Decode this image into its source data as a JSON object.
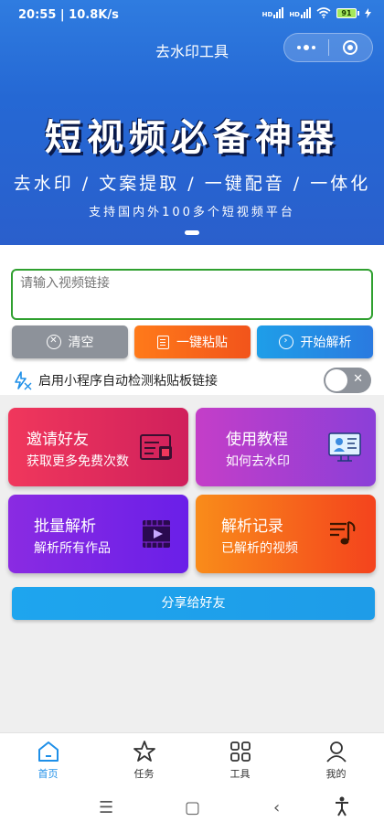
{
  "status": {
    "time": "20:55 | 10.8K/s",
    "battery": "91",
    "net1": "HD",
    "net2": "HD"
  },
  "nav": {
    "title": "去水印工具"
  },
  "banner": {
    "title": "短视频必备神器",
    "subtitle": "去水印 / 文案提取 / 一键配音 / 一体化",
    "note": "支持国内外100多个短视频平台"
  },
  "input": {
    "placeholder": "请输入视频链接",
    "value": ""
  },
  "buttons": {
    "clear": "清空",
    "paste": "一键粘贴",
    "parse": "开始解析"
  },
  "auto": {
    "label": "启用小程序自动检测粘贴板链接",
    "toggle_on": false
  },
  "cards": [
    {
      "title": "邀请好友",
      "sub": "获取更多免费次数",
      "icon": "invite-icon"
    },
    {
      "title": "使用教程",
      "sub": "如何去水印",
      "icon": "tutorial-icon"
    },
    {
      "title": "批量解析",
      "sub": "解析所有作品",
      "icon": "batch-video-icon"
    },
    {
      "title": "解析记录",
      "sub": "已解析的视频",
      "icon": "music-record-icon"
    }
  ],
  "share": "分享给好友",
  "tabs": [
    {
      "label": "首页",
      "icon": "home-icon",
      "active": true
    },
    {
      "label": "任务",
      "icon": "star-icon",
      "active": false
    },
    {
      "label": "工具",
      "icon": "grid-icon",
      "active": false
    },
    {
      "label": "我的",
      "icon": "person-icon",
      "active": false
    }
  ],
  "colors": {
    "accent": "#1e8fe8",
    "header": "#2a6ad6",
    "input_border": "#2fa02f"
  }
}
